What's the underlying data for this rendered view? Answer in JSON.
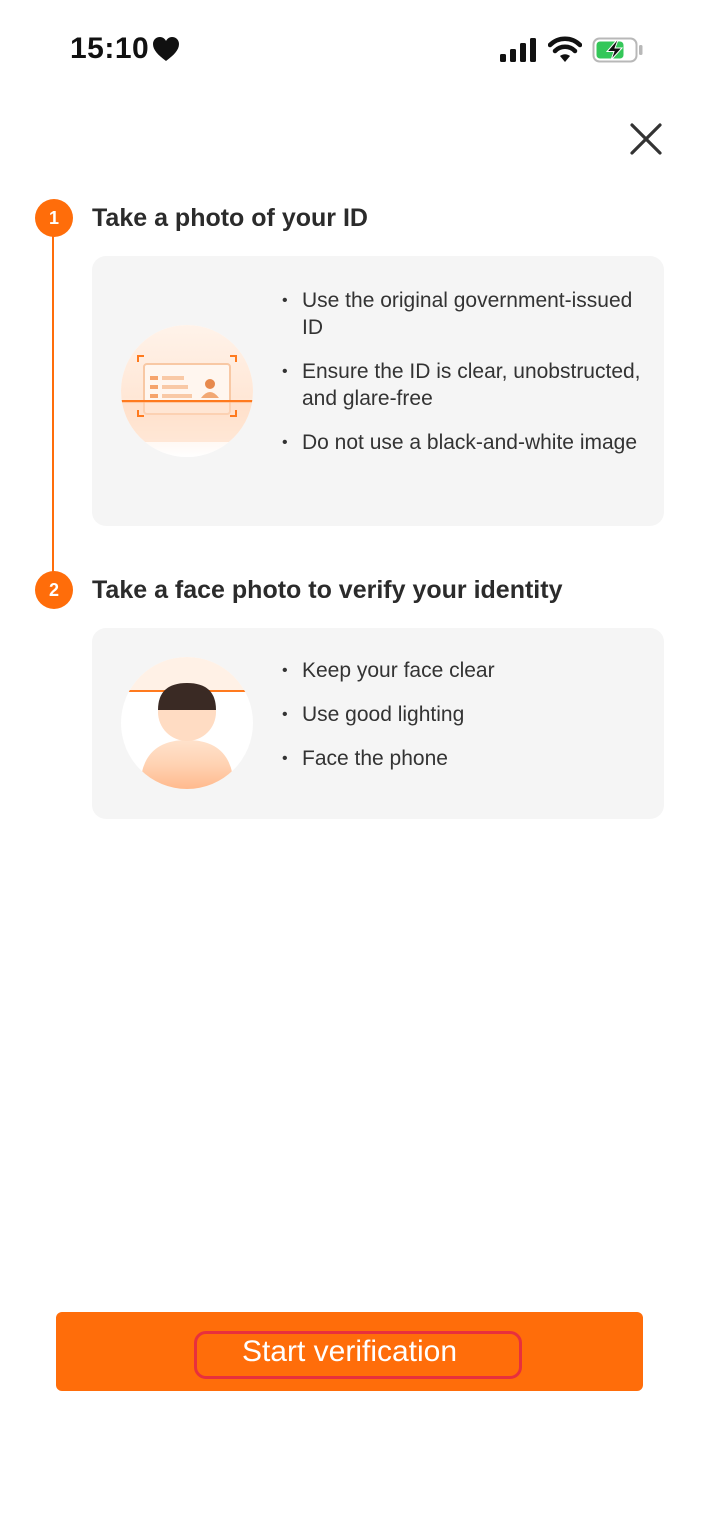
{
  "status_bar": {
    "time": "15:10",
    "icons": [
      "heart-icon",
      "cellular-signal-icon",
      "wifi-icon",
      "battery-charging-icon"
    ]
  },
  "close_button": {
    "icon": "close-icon"
  },
  "steps": [
    {
      "number": "1",
      "title": "Take a photo of your ID",
      "illustration": "id-card-illustration",
      "bullets": [
        "Use the original government-issued ID",
        "Ensure the ID is clear, unobstructed, and glare-free",
        "Do not use a black-and-white image"
      ]
    },
    {
      "number": "2",
      "title": "Take a face photo to verify your identity",
      "illustration": "face-scan-illustration",
      "bullets": [
        "Keep your face clear",
        "Use good lighting",
        "Face the phone"
      ]
    }
  ],
  "start_button": {
    "label": "Start verification"
  },
  "colors": {
    "accent": "#ff6d0a",
    "card_background": "#f5f5f5",
    "highlight_outline": "#e8303d",
    "battery_green": "#34c759"
  }
}
